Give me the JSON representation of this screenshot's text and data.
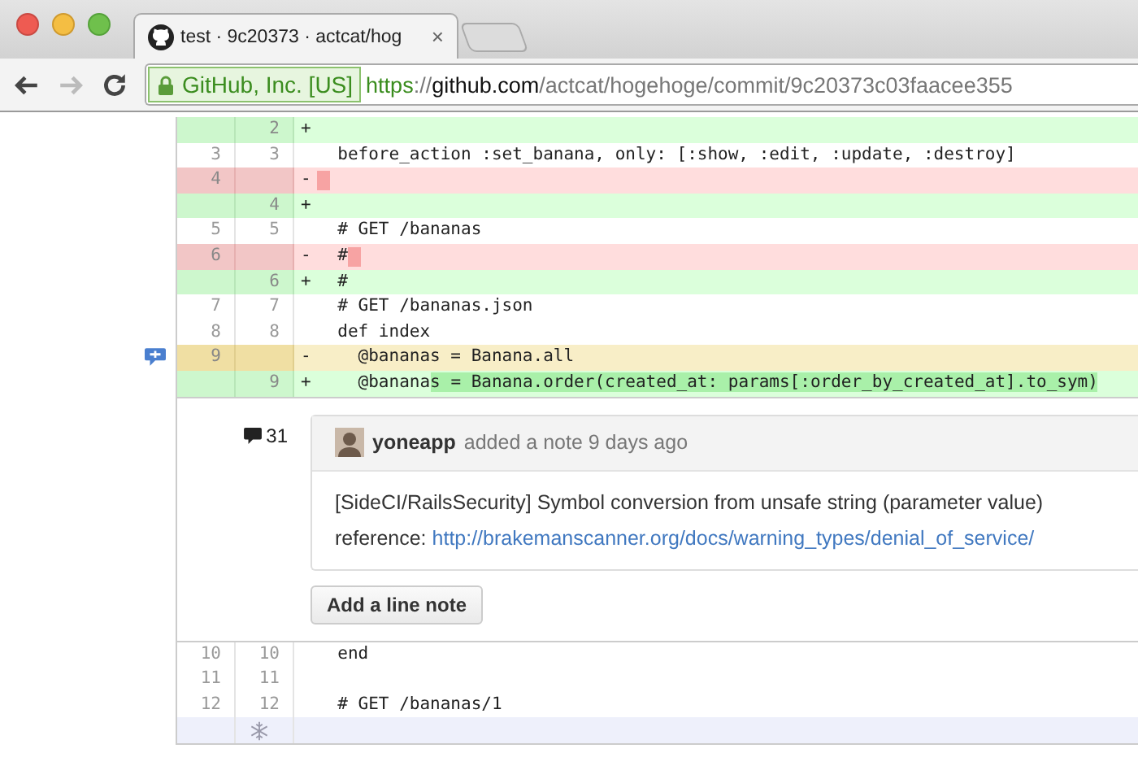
{
  "browser": {
    "tab": {
      "title": "test · 9c20373 · actcat/hog",
      "close": "×",
      "selected": true
    },
    "address": {
      "identity": "GitHub, Inc. [US]",
      "scheme": "https",
      "separator": "://",
      "host": "github.com",
      "path": "/actcat/hogehoge/commit/9c20373c03faacee355"
    },
    "forward_disabled": true
  },
  "diff": {
    "rows": [
      {
        "kind": "add",
        "new": "2",
        "sign": "+",
        "has_note": false,
        "tail_highlight": false
      },
      {
        "kind": "context",
        "old": "3",
        "new": "3",
        "has_note": false,
        "tail_highlight": false,
        "segments": [
          {
            "text": "  before_action :set_banana, only: [:show, :edit, :update, :destroy]",
            "changed": false
          }
        ]
      },
      {
        "kind": "del",
        "old": "4",
        "sign": "-",
        "has_note": false,
        "tail_highlight": true
      },
      {
        "kind": "add",
        "new": "4",
        "sign": "+",
        "has_note": false,
        "tail_highlight": false
      },
      {
        "kind": "context",
        "old": "5",
        "new": "5",
        "has_note": false,
        "tail_highlight": false,
        "segments": [
          {
            "text": "  # GET /bananas",
            "changed": false
          }
        ]
      },
      {
        "kind": "del",
        "old": "6",
        "sign": "-",
        "has_note": false,
        "tail_highlight": true,
        "segments": [
          {
            "text": "  #",
            "changed": false
          }
        ]
      },
      {
        "kind": "add",
        "new": "6",
        "sign": "+",
        "has_note": false,
        "tail_highlight": false,
        "segments": [
          {
            "text": "  #",
            "changed": false
          }
        ]
      },
      {
        "kind": "context",
        "old": "7",
        "new": "7",
        "has_note": false,
        "tail_highlight": false,
        "segments": [
          {
            "text": "  # GET /bananas.json",
            "changed": false
          }
        ]
      },
      {
        "kind": "context",
        "old": "8",
        "new": "8",
        "has_note": false,
        "tail_highlight": false,
        "segments": [
          {
            "text": "  def index",
            "changed": false
          }
        ]
      },
      {
        "kind": "del",
        "old": "9",
        "sign": "-",
        "has_note": true,
        "tail_highlight": false,
        "segments": [
          {
            "text": "    @bananas = Banana.all",
            "changed": false
          }
        ]
      },
      {
        "kind": "add",
        "new": "9",
        "sign": "+",
        "has_note": false,
        "tail_highlight": false,
        "segments": [
          {
            "text": "    @banana",
            "changed": false
          },
          {
            "text": "s = Banana.order(created_at: params[:order_by_created_at].to_sym)",
            "changed": true
          }
        ]
      }
    ],
    "note": {
      "count": "31",
      "author": "yoneapp",
      "action": "added a note 9 days ago",
      "body": "[SideCI/RailsSecurity] Symbol conversion from unsafe string (parameter value)",
      "reference_label": "reference:",
      "link": "http://brakemanscanner.org/docs/warning_types/denial_of_service/",
      "button": "Add a line note"
    },
    "rows_after": [
      {
        "kind": "context",
        "old": "10",
        "new": "10",
        "has_note": false,
        "tail_highlight": false,
        "segments": [
          {
            "text": "  end",
            "changed": false
          }
        ]
      },
      {
        "kind": "context",
        "old": "11",
        "new": "11",
        "has_note": false,
        "tail_highlight": false
      },
      {
        "kind": "context",
        "old": "12",
        "new": "12",
        "has_note": false,
        "tail_highlight": false,
        "segments": [
          {
            "text": "  # GET /bananas/1",
            "changed": false
          }
        ]
      },
      {
        "kind": "expand",
        "has_note": false,
        "tail_highlight": false
      }
    ]
  }
}
